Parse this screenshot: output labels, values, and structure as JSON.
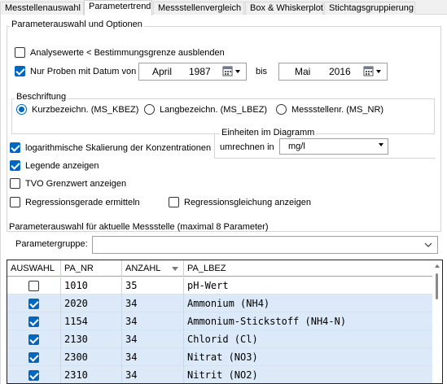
{
  "tabs": [
    {
      "label": "Messtellenauswahl",
      "active": false
    },
    {
      "label": "Parametertrend",
      "active": true
    },
    {
      "label": "Messstellenvergleich",
      "active": false
    },
    {
      "label": "Box & Whiskerplot",
      "active": false
    },
    {
      "label": "Stichtagsgruppierung",
      "active": false
    }
  ],
  "options": {
    "title": "Parameterauswahl und Optionen",
    "hide_below_limit": {
      "label": "Analysewerte < Bestimmungsgrenze ausblenden",
      "checked": false
    },
    "date_filter": {
      "label": "Nur Proben mit Datum von",
      "checked": true
    },
    "date_from": {
      "month": "April",
      "year": "1987"
    },
    "bis_label": "bis",
    "date_to": {
      "month": "Mai",
      "year": "2016"
    },
    "beschriftung": {
      "title": "Beschriftung",
      "options": [
        {
          "label": "Kurzbezeichn. (MS_KBEZ)",
          "selected": true
        },
        {
          "label": "Langbezeichn. (MS_LBEZ)",
          "selected": false
        },
        {
          "label": "Messstellenr. (MS_NR)",
          "selected": false
        }
      ]
    },
    "log_scale": {
      "label": "logarithmische Skalierung der Konzentrationen",
      "checked": true
    },
    "show_legend": {
      "label": "Legende anzeigen",
      "checked": true
    },
    "tvo": {
      "label": "TVO Grenzwert anzeigen",
      "checked": false
    },
    "regression_line": {
      "label": "Regressionsgerade ermitteln",
      "checked": false
    },
    "regression_eq": {
      "label": "Regressionsgleichung anzeigen",
      "checked": false
    },
    "units": {
      "title": "Einheiten im Diagramm",
      "convert_label": "umrechnen in",
      "value": "mg/l"
    }
  },
  "param_section": {
    "title": "Parameterauswahl für aktuelle Messstelle (maximal 8 Parameter)",
    "group_label": "Parametergruppe:",
    "group_value": ""
  },
  "table": {
    "columns": [
      "AUSWAHL",
      "PA_NR",
      "ANZAHL",
      "PA_LBEZ"
    ],
    "rows": [
      {
        "checked": false,
        "pa_nr": "1010",
        "anzahl": "35",
        "pa_lbez": "pH-Wert"
      },
      {
        "checked": true,
        "pa_nr": "2020",
        "anzahl": "34",
        "pa_lbez": "Ammonium (NH4)"
      },
      {
        "checked": true,
        "pa_nr": "1154",
        "anzahl": "34",
        "pa_lbez": "Ammonium-Stickstoff (NH4-N)"
      },
      {
        "checked": true,
        "pa_nr": "2130",
        "anzahl": "34",
        "pa_lbez": "Chlorid (Cl)"
      },
      {
        "checked": true,
        "pa_nr": "2300",
        "anzahl": "34",
        "pa_lbez": "Nitrat (NO3)"
      },
      {
        "checked": true,
        "pa_nr": "2310",
        "anzahl": "34",
        "pa_lbez": "Nitrit (NO2)"
      }
    ]
  },
  "colors": {
    "accent": "#0067c0",
    "selected_row": "#dbe9f8"
  },
  "icons": [
    "calendar-icon",
    "dropdown-arrow-icon",
    "sort-desc-icon",
    "scroll-up-icon"
  ]
}
